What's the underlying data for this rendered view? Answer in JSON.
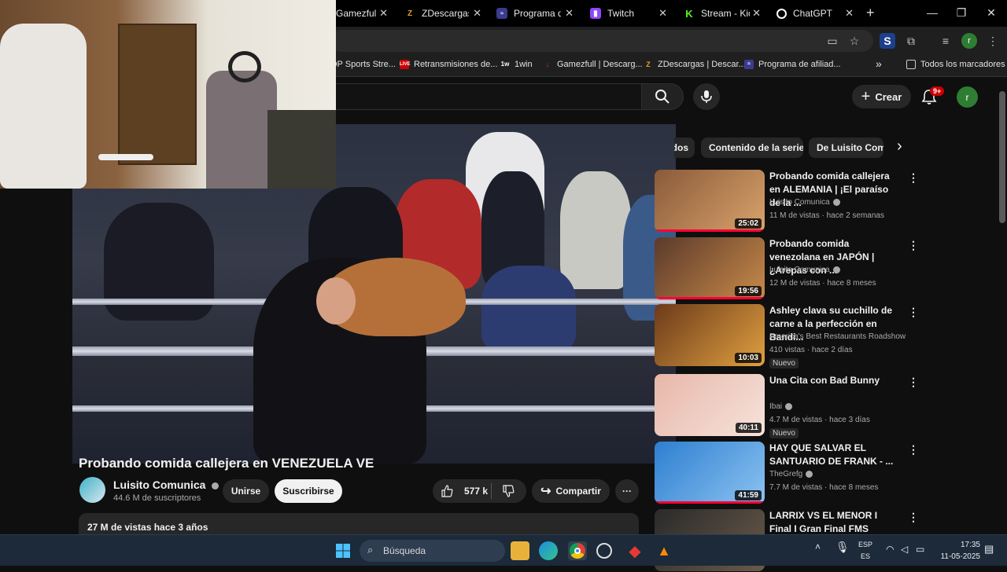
{
  "browser": {
    "tabs": [
      {
        "label": "Gamezfull | D",
        "favicon": "gamezfull-icon",
        "color": "#c0392b"
      },
      {
        "label": "ZDescargas |",
        "favicon": "zdescargas-icon",
        "color": "#e0a030"
      },
      {
        "label": "Programa de",
        "favicon": "afiliados-icon",
        "color": "#3b3b8f"
      },
      {
        "label": "Twitch",
        "favicon": "twitch-icon",
        "color": "#9146ff"
      },
      {
        "label": "Stream - Kick",
        "favicon": "kick-icon",
        "color": "#53fc18"
      },
      {
        "label": "ChatGPT",
        "favicon": "chatgpt-icon",
        "color": "#ffffff"
      }
    ],
    "new_tab": "+",
    "bookmarks": [
      {
        "label": "OP Sports Stre...",
        "color": "#555"
      },
      {
        "label": "Retransmisiones de...",
        "color": "#cc0000"
      },
      {
        "label": "1win",
        "color": "#2563eb"
      },
      {
        "label": "Gamezfull | Descarg...",
        "color": "#c0392b"
      },
      {
        "label": "ZDescargas | Descar...",
        "color": "#e0a030"
      },
      {
        "label": "Programa de afiliad...",
        "color": "#3b3b8f"
      }
    ],
    "bookmarks_more": "»",
    "all_bookmarks": "Todos los marcadores",
    "profile_initial": "r"
  },
  "youtube": {
    "create_label": "Crear",
    "notifications_badge": "9+",
    "avatar_initial": "r",
    "video_title": "Probando comida callejera en VENEZUELA VE",
    "channel_name": "Luisito Comunica",
    "subscribers": "44.6 M de suscriptores",
    "join_label": "Unirse",
    "subscribe_label": "Suscribirse",
    "likes": "577 k",
    "share_label": "Compartir",
    "more_label": "···",
    "description": "27 M de vistas  hace 3 años",
    "chips": [
      "dos",
      "Contenido de la serie",
      "De Luisito Comu"
    ],
    "chips_next": "›",
    "recommendations": [
      {
        "title": "Probando comida callejera en ALEMANIA | ¡El paraíso de la ...",
        "channel": "Luisito Comunica",
        "verified": true,
        "meta": "11 M de vistas · hace 2 semanas",
        "duration": "25:02",
        "badge": "",
        "thumb_a": "#8a5a3a",
        "thumb_b": "#d9a36b",
        "progress": 1.0
      },
      {
        "title": "Probando comida venezolana en JAPÓN | ¿Arepas con ...",
        "channel": "Luisito Comunica",
        "verified": true,
        "meta": "12 M de vistas · hace 8 meses",
        "duration": "19:56",
        "badge": "",
        "thumb_a": "#5a3a2a",
        "thumb_b": "#c98a4a",
        "progress": 1.0
      },
      {
        "title": "Ashley clava su cuchillo de carne a la perfección en Bandi...",
        "channel": "America's Best Restaurants Roadshow",
        "verified": false,
        "meta": "410 vistas · hace 2 días",
        "duration": "10:03",
        "badge": "Nuevo",
        "thumb_a": "#6b3a1a",
        "thumb_b": "#e0a040",
        "progress": 0
      },
      {
        "title": "Una Cita con Bad Bunny",
        "channel": "Ibai",
        "verified": true,
        "meta": "4.7 M de vistas · hace 3 días",
        "duration": "40:11",
        "badge": "Nuevo",
        "thumb_a": "#e7b7a8",
        "thumb_b": "#f6e3dc",
        "progress": 0
      },
      {
        "title": "HAY QUE SALVAR EL SANTUARIO DE FRANK - ...",
        "channel": "TheGrefg",
        "verified": true,
        "meta": "7.7 M de vistas · hace 8 meses",
        "duration": "41:59",
        "badge": "",
        "thumb_a": "#2d7fd1",
        "thumb_b": "#8cc2f0",
        "progress": 1.0
      },
      {
        "title": "LARRIX VS EL MENOR I Final I Gran Final FMS Internacional ...",
        "channel": "",
        "verified": false,
        "meta": "",
        "duration": "",
        "badge": "",
        "thumb_a": "#2a2a2a",
        "thumb_b": "#6a5a4a",
        "progress": 0
      }
    ]
  },
  "taskbar": {
    "search_placeholder": "Búsqueda",
    "lang_line1": "ESP",
    "lang_line2": "ES",
    "time": "17:35",
    "date": "11-05-2025"
  }
}
